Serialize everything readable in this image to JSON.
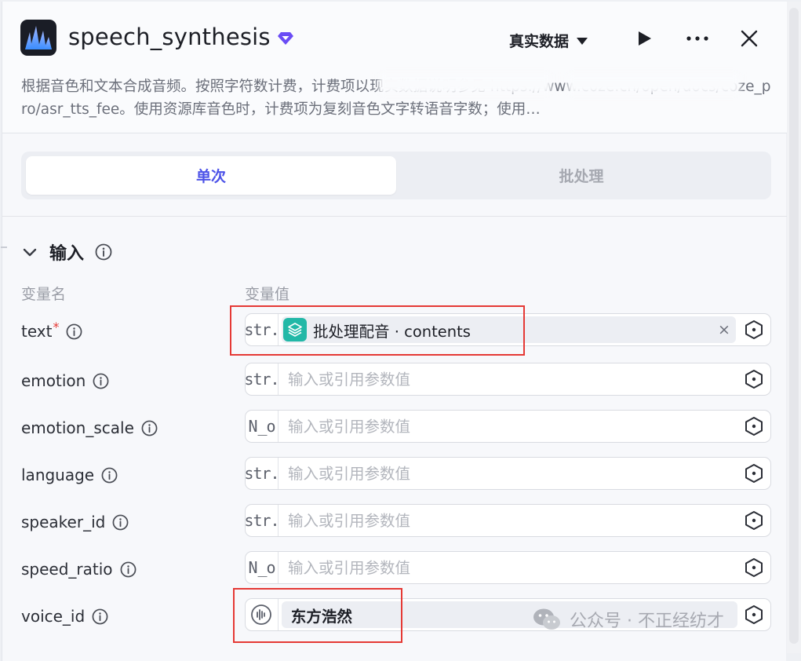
{
  "header": {
    "title": "speech_synthesis",
    "mode_label": "真实数据",
    "description": "根据音色和文本合成音频。按照字符数计费，计费项以现实数据说明参见 https://www.coze.cn/open/docs/coze_pro/asr_tts_fee。使用资源库音色时，计费项为复刻音色文字转语音字数；使用…"
  },
  "tabs": [
    {
      "label": "单次",
      "active": true
    },
    {
      "label": "批处理",
      "active": false
    }
  ],
  "input_section": {
    "title": "输入",
    "col_name": "变量名",
    "col_value": "变量值",
    "placeholder": "输入或引用参数值",
    "rows": [
      {
        "name": "text",
        "required": "*",
        "type": "str.",
        "ref_label": "批处理配音 · contents"
      },
      {
        "name": "emotion",
        "type": "str."
      },
      {
        "name": "emotion_scale",
        "type": "N̲o"
      },
      {
        "name": "language",
        "type": "str."
      },
      {
        "name": "speaker_id",
        "type": "str."
      },
      {
        "name": "speed_ratio",
        "type": "N̲o"
      },
      {
        "name": "voice_id",
        "type": "voice",
        "voice_label": "东方浩然"
      }
    ]
  },
  "watermark": {
    "text": "公众号 · 不正经纺才"
  },
  "colors": {
    "accent": "#4d53e8",
    "highlight_box": "#e53935",
    "chip_teal": "#22b8a7"
  }
}
